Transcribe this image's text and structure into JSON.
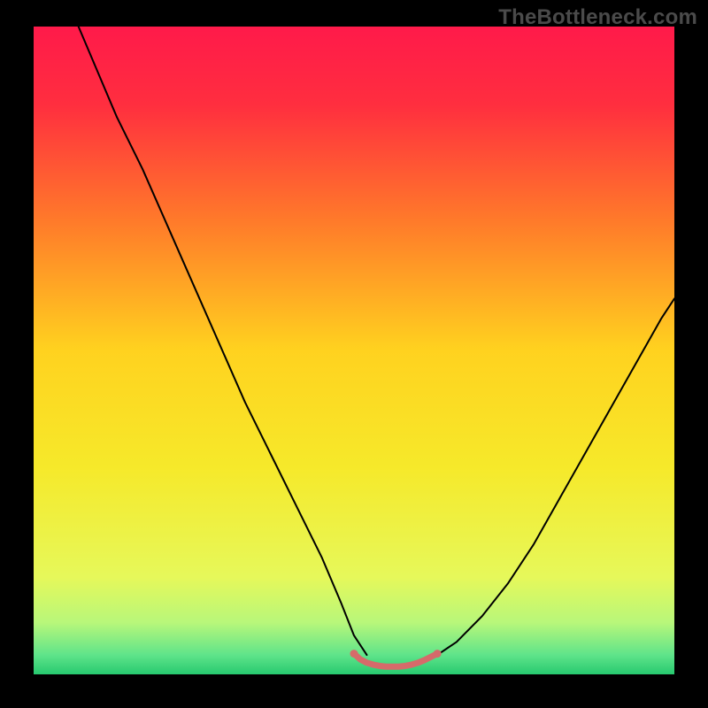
{
  "watermark": {
    "text": "TheBottleneck.com"
  },
  "chart_data": {
    "type": "line",
    "title": "",
    "xlabel": "",
    "ylabel": "",
    "xlim": [
      0,
      100
    ],
    "ylim": [
      0,
      100
    ],
    "grid": false,
    "legend": false,
    "background_gradient_stops": [
      {
        "pos": 0.0,
        "color": "#ff1a4a"
      },
      {
        "pos": 0.12,
        "color": "#ff2e3f"
      },
      {
        "pos": 0.3,
        "color": "#ff7a2a"
      },
      {
        "pos": 0.5,
        "color": "#ffd21f"
      },
      {
        "pos": 0.68,
        "color": "#f6e92a"
      },
      {
        "pos": 0.85,
        "color": "#e6f85a"
      },
      {
        "pos": 0.92,
        "color": "#b8f77a"
      },
      {
        "pos": 0.97,
        "color": "#5fe48a"
      },
      {
        "pos": 1.0,
        "color": "#27c96f"
      }
    ],
    "series": [
      {
        "name": "left-curve",
        "stroke": "#000000",
        "stroke_width": 2,
        "x": [
          7,
          10,
          13,
          17,
          21,
          25,
          29,
          33,
          37,
          41,
          45,
          48,
          50,
          52
        ],
        "y": [
          100,
          93,
          86,
          78,
          69,
          60,
          51,
          42,
          34,
          26,
          18,
          11,
          6,
          3
        ]
      },
      {
        "name": "right-curve",
        "stroke": "#000000",
        "stroke_width": 2,
        "x": [
          63,
          66,
          70,
          74,
          78,
          82,
          86,
          90,
          94,
          98,
          100
        ],
        "y": [
          3,
          5,
          9,
          14,
          20,
          27,
          34,
          41,
          48,
          55,
          58
        ]
      },
      {
        "name": "floor-band",
        "stroke": "#d66a6a",
        "stroke_width": 7,
        "x": [
          50,
          51,
          52,
          53,
          54,
          55,
          56,
          57,
          58,
          59,
          60,
          61,
          62,
          63
        ],
        "y": [
          3.2,
          2.3,
          1.8,
          1.5,
          1.3,
          1.2,
          1.2,
          1.2,
          1.3,
          1.5,
          1.8,
          2.2,
          2.7,
          3.2
        ]
      }
    ],
    "markers": [
      {
        "name": "floor-end-left",
        "x": 50,
        "y": 3.2,
        "r": 4.5,
        "color": "#d66a6a"
      },
      {
        "name": "floor-end-right",
        "x": 63,
        "y": 3.2,
        "r": 4.5,
        "color": "#d66a6a"
      }
    ]
  }
}
